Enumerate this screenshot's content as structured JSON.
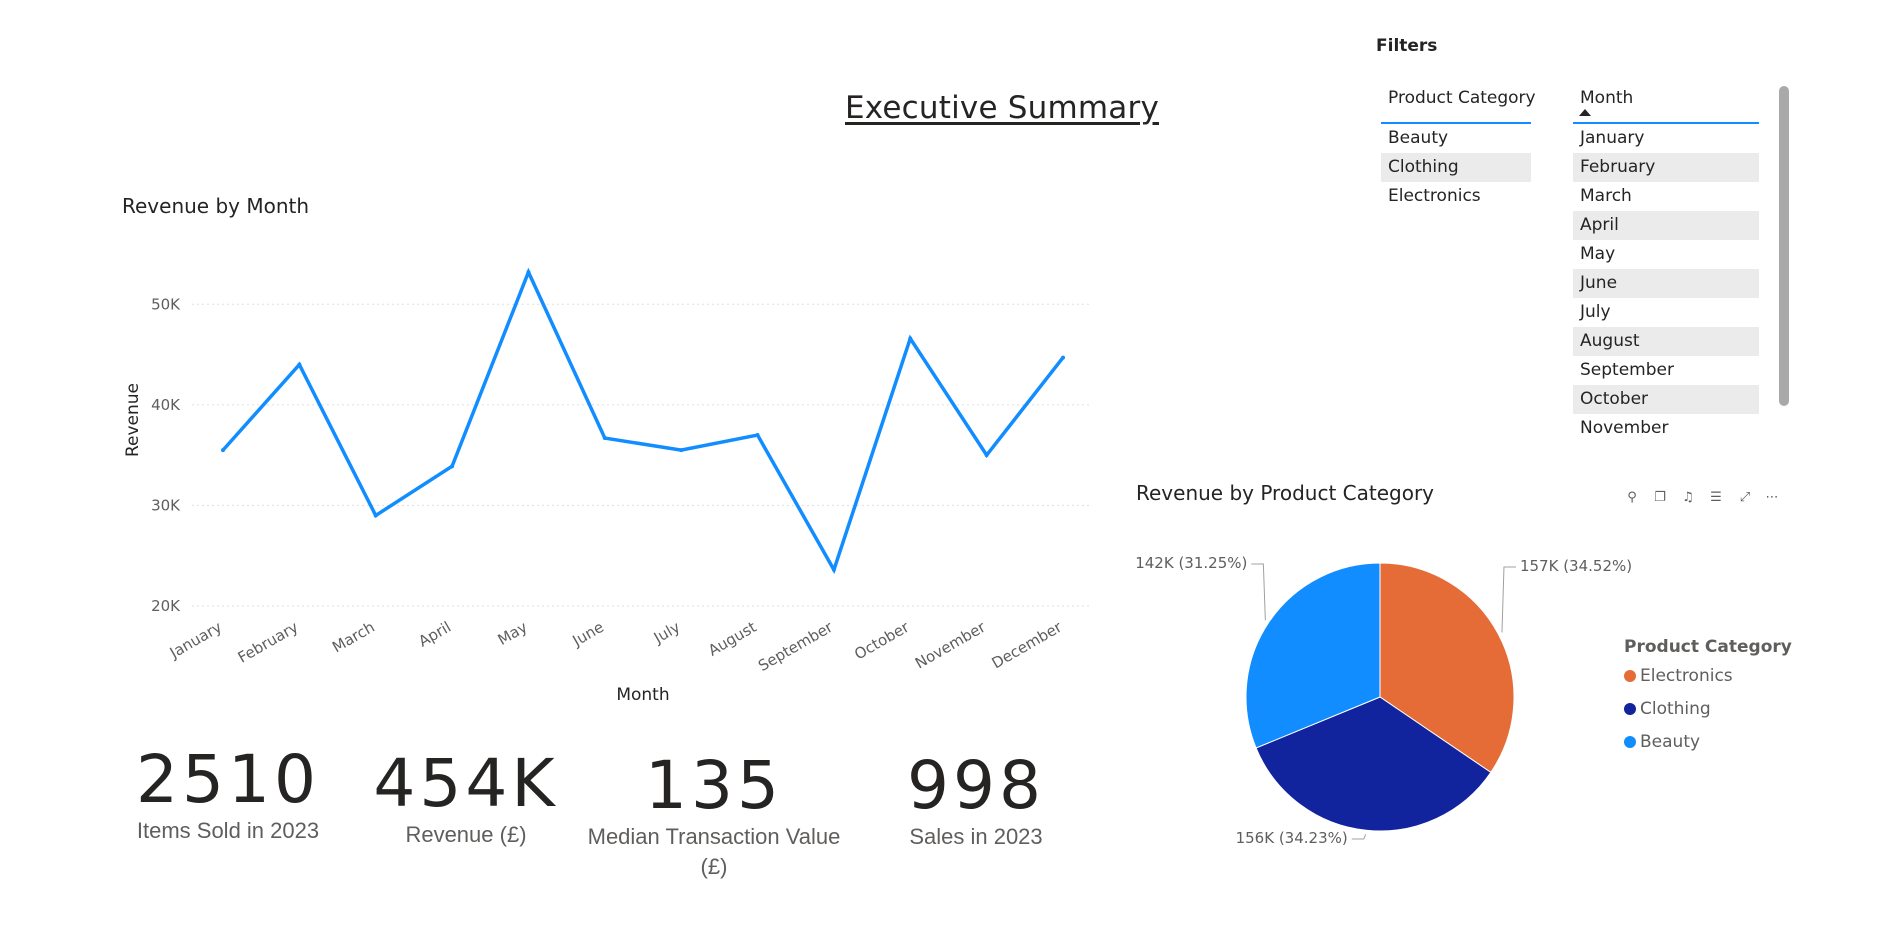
{
  "page": {
    "title": "Executive Summary"
  },
  "filters": {
    "title": "Filters",
    "product_category": {
      "header": "Product Category",
      "items": [
        "Beauty",
        "Clothing",
        "Electronics"
      ]
    },
    "month": {
      "header": "Month",
      "items": [
        "January",
        "February",
        "March",
        "April",
        "May",
        "June",
        "July",
        "August",
        "September",
        "October",
        "November"
      ]
    }
  },
  "kpis": [
    {
      "value": "2510",
      "label": "Items Sold in 2023"
    },
    {
      "value": "454K",
      "label": "Revenue (£)"
    },
    {
      "value": "135",
      "label": "Median Transaction Value (£)"
    },
    {
      "value": "998",
      "label": "Sales in 2023"
    }
  ],
  "visual_header_icons": [
    "pin-icon",
    "copy-icon",
    "bell-icon",
    "filter-icon",
    "focus-mode-icon",
    "more-options-icon"
  ],
  "chart_data": [
    {
      "type": "line",
      "title": "Revenue by Month",
      "xlabel": "Month",
      "ylabel": "Revenue",
      "categories": [
        "January",
        "February",
        "March",
        "April",
        "May",
        "June",
        "July",
        "August",
        "September",
        "October",
        "November",
        "December"
      ],
      "series": [
        {
          "values": [
            35500,
            44000,
            29000,
            33900,
            53200,
            36700,
            35500,
            37000,
            23600,
            46600,
            35000,
            44700
          ],
          "color": "#118dff"
        }
      ],
      "ylim": [
        20000,
        55000
      ],
      "yticks": [
        20000,
        30000,
        40000,
        50000
      ],
      "ytick_labels": [
        "20K",
        "30K",
        "40K",
        "50K"
      ],
      "grid": true
    },
    {
      "type": "pie",
      "title": "Revenue by Product Category",
      "legend_title": "Product Category",
      "legend_position": "right",
      "slices": [
        {
          "name": "Electronics",
          "value": 157,
          "label": "157K (34.52%)",
          "color": "#e66c37"
        },
        {
          "name": "Clothing",
          "value": 156,
          "label": "156K (34.23%)",
          "color": "#12239e"
        },
        {
          "name": "Beauty",
          "value": 142,
          "label": "142K (31.25%)",
          "color": "#118dff"
        }
      ]
    }
  ]
}
